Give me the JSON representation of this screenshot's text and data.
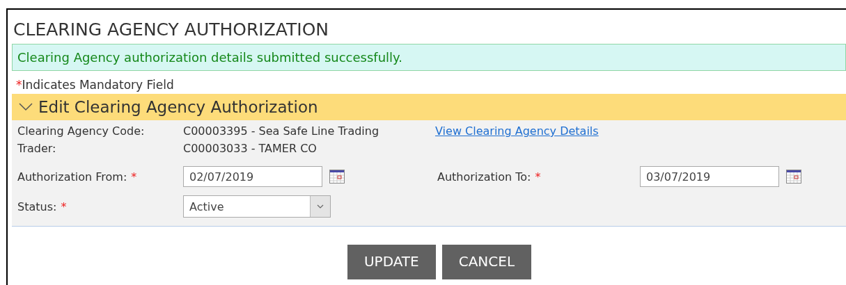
{
  "page": {
    "title": "CLEARING AGENCY AUTHORIZATION"
  },
  "message": {
    "text": "Clearing Agency authorization details submitted successfully."
  },
  "mandatory_note": {
    "mark": "*",
    "text": "Indicates Mandatory Field"
  },
  "section": {
    "title": "Edit Clearing Agency Authorization",
    "expanded": true
  },
  "info": [
    {
      "label": "Clearing Agency Code:",
      "value": "C00003395 - Sea Safe Line Trading",
      "link": "View Clearing Agency Details"
    },
    {
      "label": "Trader:",
      "value": "C00003033 - TAMER CO"
    }
  ],
  "fields": [
    {
      "kind": "date",
      "label": "Authorization From:",
      "required_mark": "*",
      "value": "02/07/2019"
    },
    {
      "kind": "date",
      "label": "Authorization To:",
      "required_mark": "*",
      "value": "03/07/2019"
    },
    {
      "kind": "select",
      "label": "Status:",
      "required_mark": "*",
      "value": "Active"
    }
  ],
  "buttons": [
    "UPDATE",
    "CANCEL"
  ]
}
